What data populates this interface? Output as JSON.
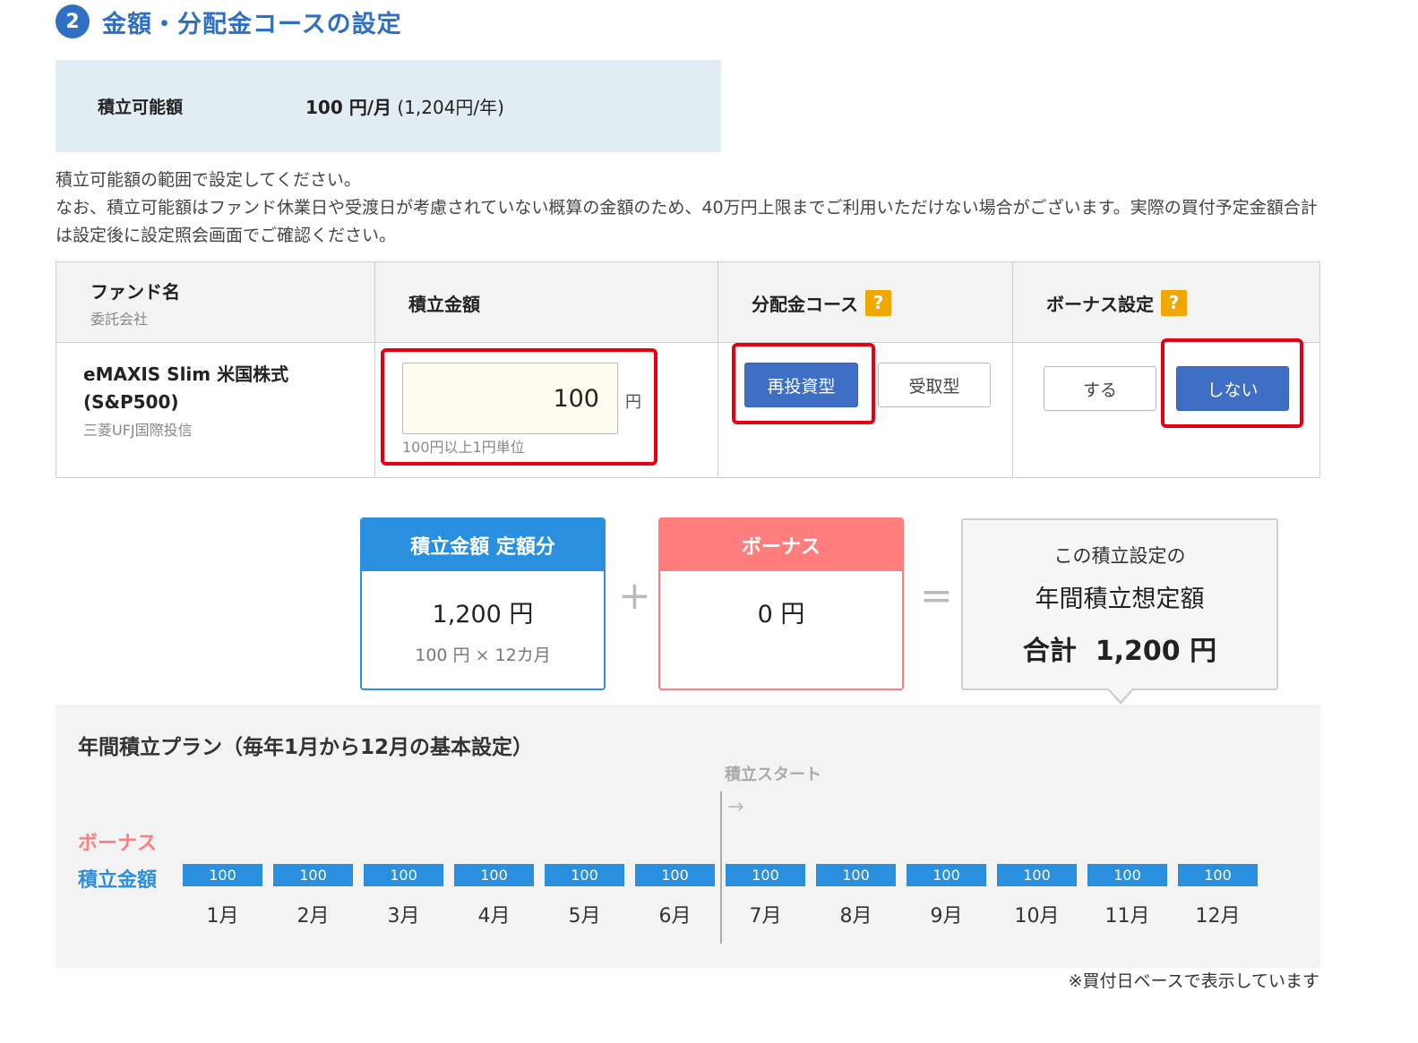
{
  "section": {
    "step_number": "2",
    "title": "金額・分配金コースの設定"
  },
  "available": {
    "label": "積立可能額",
    "value_bold": "100 円/月",
    "value_note": " (1,204円/年)"
  },
  "notes": {
    "line1": "積立可能額の範囲で設定してください。",
    "line2": "なお、積立可能額はファンド休業日や受渡日が考慮されていない概算の金額のため、40万円上限までご利用いただけない場合がございます。実際の買付予定金額合計は設定後に設定照会画面でご確認ください。"
  },
  "table": {
    "headers": {
      "fund": "ファンド名",
      "fund_sub": "委託会社",
      "amount": "積立金額",
      "dividend": "分配金コース",
      "bonus": "ボーナス設定",
      "help": "?"
    },
    "row": {
      "fund_name_line1": "eMAXIS Slim 米国株式",
      "fund_name_line2": "(S&P500)",
      "company": "三菱UFJ国際投信",
      "amount_value": "100",
      "amount_unit": "円",
      "amount_hint": "100円以上1円単位",
      "dividend_options": [
        "再投資型",
        "受取型"
      ],
      "dividend_selected": "再投資型",
      "bonus_options": [
        "する",
        "しない"
      ],
      "bonus_selected": "しない"
    }
  },
  "summary": {
    "fixed": {
      "title": "積立金額 定額分",
      "amount": "1,200 円",
      "breakdown": "100 円 × 12カ月"
    },
    "plus": "+",
    "bonus": {
      "title": "ボーナス",
      "amount": "0 円"
    },
    "equals": "=",
    "total": {
      "line1": "この積立設定の",
      "line2": "年間積立想定額",
      "line3": "合計  1,200 円"
    }
  },
  "plan": {
    "title": "年間積立プラン（毎年1月から12月の基本設定）",
    "start_label": "積立スタート",
    "start_arrow": "→",
    "bonus_label": "ボーナス",
    "amount_label": "積立金額",
    "months": [
      {
        "month": "1月",
        "value": "100"
      },
      {
        "month": "2月",
        "value": "100"
      },
      {
        "month": "3月",
        "value": "100"
      },
      {
        "month": "4月",
        "value": "100"
      },
      {
        "month": "5月",
        "value": "100"
      },
      {
        "month": "6月",
        "value": "100"
      },
      {
        "month": "7月",
        "value": "100"
      },
      {
        "month": "8月",
        "value": "100"
      },
      {
        "month": "9月",
        "value": "100"
      },
      {
        "month": "10月",
        "value": "100"
      },
      {
        "month": "11月",
        "value": "100"
      },
      {
        "month": "12月",
        "value": "100"
      }
    ],
    "footnote": "※買付日ベースで表示しています"
  },
  "colors": {
    "accent": "#2f6fc4",
    "highlight": "#e60012",
    "fixed_card": "#2b8fe0",
    "bonus_card": "#ff7d7d",
    "help_icon": "#f0a800"
  }
}
